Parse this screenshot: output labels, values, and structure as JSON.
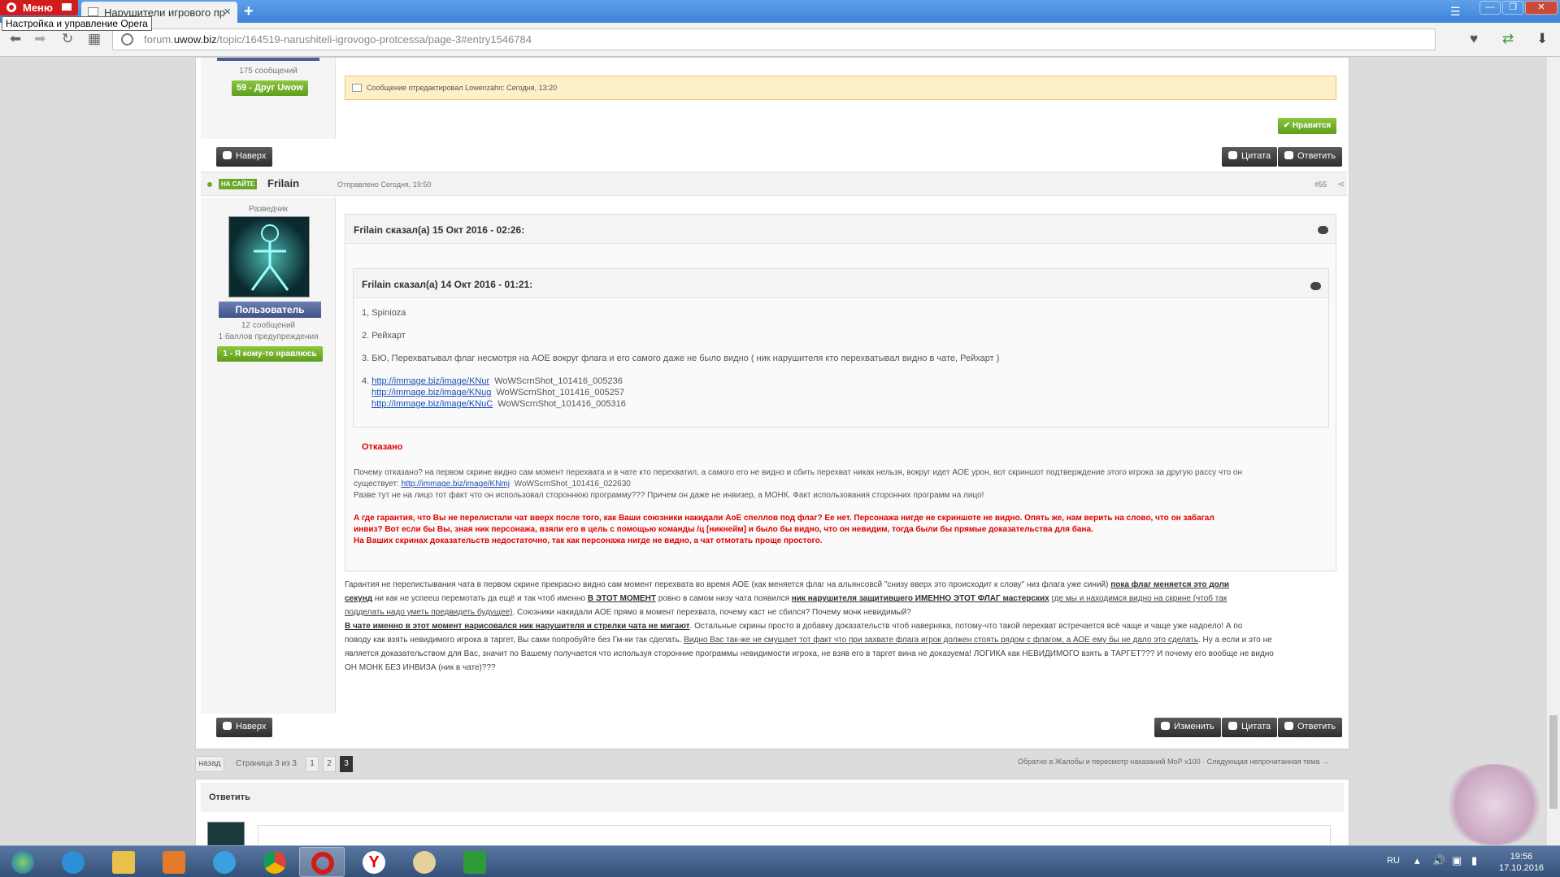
{
  "browser": {
    "menu_label": "Меню",
    "tooltip": "Настройка и управление Opera",
    "tab_title": "Нарушители игрового пр",
    "tab_close": "×",
    "new_tab": "+",
    "url_prefix": "forum.",
    "url_domain": "uwow.biz",
    "url_path": "/topic/164519-narushiteli-igrovogo-protcessa/page-3#entry1546784"
  },
  "prev_post": {
    "messages": "175 сообщений",
    "rep": "59 - Друг Uwow",
    "edited_notice": "Сообщение отредактировал Lowenzahn: Сегодня, 13:20",
    "like_label": "Нравится",
    "top_label": "Наверх",
    "quote_label": "Цитата",
    "reply_label": "Ответить"
  },
  "post": {
    "online_badge": "НА САЙТЕ",
    "author": "Frilain",
    "posted": "Отправлено Сегодня, 19:50",
    "post_number": "#55",
    "rank": "Разведчик",
    "group": "Пользователь",
    "messages": "12 сообщений",
    "warnings": "1 баллов предупреждения",
    "rep": "1 - Я кому-то нравлюсь",
    "outer_quote_head": "Frilain сказал(а) 15 Окт 2016 - 02:26:",
    "inner_quote_head": "Frilain сказал(а) 14 Окт 2016 - 01:21:",
    "inner_lines": [
      "1, Spinioza",
      "2. Рейхарт",
      "3. БЮ, Перехватывал флаг несмотря на АОЕ вокруг флага и его самого даже не было видно ( ник нарушителя кто перехватывал видно в чате, Рейхарт )"
    ],
    "inner_links": [
      {
        "prefix": "4. ",
        "url": "http://immage.biz/image/KNur",
        "file": "WoWScrnShot_101416_005236"
      },
      {
        "prefix": "",
        "url": "http://immage.biz/image/KNug",
        "file": "WoWScrnShot_101416_005257"
      },
      {
        "prefix": "",
        "url": "http://immage.biz/image/KNuC",
        "file": "WoWScrnShot_101416_005316"
      }
    ],
    "inner_verdict": "Отказано",
    "outer_text_1": "Почему отказано? на первом скрине видно сам момент перехвата и в чате кто перехватил, а самого его не видно и сбить перехват никак нельзя, вокруг идет АОЕ урон, вот скриншот подтверждение этого игрока за другую рассу что он",
    "outer_text_2_prefix": "существует: ",
    "outer_text_2_link": "http://immage.biz/image/KNmj",
    "outer_text_2_file": "WoWScrnShot_101416_022630",
    "outer_text_3": "Разве  тут не на лицо тот факт что он использовал стороннюю программу??? Причем он даже не инвизер, а МОНК. Факт использования сторонних программ на лицо!",
    "moderator_red": [
      "А где гарантия, что Вы не перелистали чат вверх после того, как Ваши союзники накидали АоЕ спеллов под флаг? Ее нет. Персонажа нигде не скриншоте не видно. Опять же, нам верить на слово, что он забагал",
      "инвиз? Вот если бы Вы, зная ник персонажа, взяли его в цель с помощью команды /ц [никнейм] и было бы видно, что он невидим, тогда были бы прямые доказательства для бана.",
      "На Ваших скринах доказательств недостаточно, так как персонажа нигде не видно, а чат отмотать проще простого."
    ],
    "reply_body": [
      {
        "segments": [
          {
            "t": "Гарантия не перелистывания чата в первом скрине прекрасно видно сам момент перехвата во время АОЕ (как меняется флаг на альянсовсй \"снизу вверх это происходит к слову\" низ флага уже синий) ",
            "s": "n"
          },
          {
            "t": "пока флаг меняется это доли",
            "s": "b"
          }
        ]
      },
      {
        "segments": [
          {
            "t": "секунд",
            "s": "b"
          },
          {
            "t": " ни как не успееш перемотать да ещё и так чтоб именно ",
            "s": "n"
          },
          {
            "t": "В ЭТОТ МОМЕНТ",
            "s": "b"
          },
          {
            "t": " ровно в самом низу чата появился ",
            "s": "n"
          },
          {
            "t": "ник нарушителя защитившего ИМЕННО ЭТОТ ФЛАГ мастерских",
            "s": "b"
          },
          {
            "t": " ",
            "s": "n"
          },
          {
            "t": "где мы и находимся видно на скрине (чтоб так",
            "s": "u"
          }
        ]
      },
      {
        "segments": [
          {
            "t": "подделать надо уметь предвидеть будущее)",
            "s": "u"
          },
          {
            "t": ". Союзники накидали АОЕ прямо в момент перехвата, почему каст не сбился? Почему монк невидимый?",
            "s": "n"
          }
        ]
      },
      {
        "segments": [
          {
            "t": "В чате именно в этот момент нарисовался ник нарушителя и стрелки чата не мигают",
            "s": "b"
          },
          {
            "t": ". Остальные скрины просто в добавку доказательств чтоб наверняка, потому-что такой перехват встречается всё чаще и чаще уже надоело! А по",
            "s": "n"
          }
        ]
      },
      {
        "segments": [
          {
            "t": "поводу как взять невидимого игрока в таргет, Вы сами попробуйте без Гм-ки так сделать. ",
            "s": "n"
          },
          {
            "t": "Видно Вас так-же не смущает тот факт что при захвате флага игрок должен стоять рядом с флагом, а АОЕ ему бы не дало это сделать",
            "s": "u"
          },
          {
            "t": ". Ну а если и это не",
            "s": "n"
          }
        ]
      },
      {
        "segments": [
          {
            "t": "является доказательством для Вас, значит по Вашему получается что используя сторонние программы невидимости игрока, не взяв его в таргет вина не доказуема! ЛОГИКА как НЕВИДИМОГО взять в ТАРГЕТ??? И почему его вообще не видно",
            "s": "n"
          }
        ]
      },
      {
        "segments": [
          {
            "t": "ОН МОНК БЕЗ ИНВИЗА (ник в чате)???",
            "s": "n"
          }
        ]
      }
    ],
    "top_label": "Наверх",
    "edit_label": "Изменить",
    "quote_label": "Цитата",
    "reply_label": "Ответить"
  },
  "pagination": {
    "back": "назад",
    "page_of": "Страница 3 из 3",
    "pages": [
      "1",
      "2",
      "3"
    ],
    "current": "3",
    "right_text": "Обратно в Жалобы и пересмотр наказаний МоР х100 · Следующая непрочитанная тема →"
  },
  "reply_section": {
    "title": "Ответить"
  },
  "taskbar": {
    "lang": "RU",
    "time": "19:56",
    "date": "17.10.2016"
  },
  "colors": {
    "accent_red": "#d21b1b",
    "green": "#6aa82a",
    "link": "#1a4fb8",
    "moderator_red": "#e00000"
  }
}
